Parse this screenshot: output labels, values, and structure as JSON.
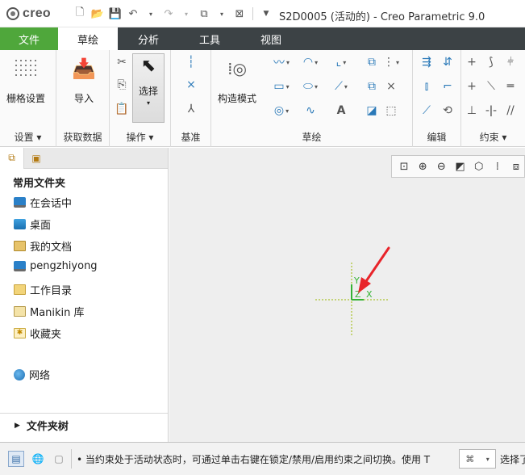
{
  "app": {
    "logo_text": "creo",
    "window_title": "S2D0005 (活动的) - Creo Parametric 9.0"
  },
  "tabs": [
    "文件",
    "草绘",
    "分析",
    "工具",
    "视图"
  ],
  "ribbon": {
    "groups": {
      "setup": "设置",
      "get_data": "获取数据",
      "operations": "操作",
      "datum": "基准",
      "sketch": "草绘",
      "edit": "编辑",
      "constrain": "约束"
    },
    "buttons": {
      "grid_settings": "栅格设置",
      "import": "导入",
      "select": "选择",
      "construction_mode": "构造模式"
    }
  },
  "panel": {
    "heading": "常用文件夹",
    "folders": [
      "在会话中",
      "桌面",
      "我的文档",
      "pengzhiyong",
      "工作目录",
      "Manikin 库",
      "收藏夹",
      "网络"
    ],
    "folder_tree": "文件夹树"
  },
  "graphics": {
    "axis_y": "Y",
    "axis_z": "Z",
    "axis_x": "X",
    "annotation_color": "#e8242a",
    "axis_color": "#35b234"
  },
  "status": {
    "message": "当约束处于活动状态时，可通过单击右键在锁定/禁用/启用约束之间切换。使用 T",
    "filter_label": "选择了"
  }
}
